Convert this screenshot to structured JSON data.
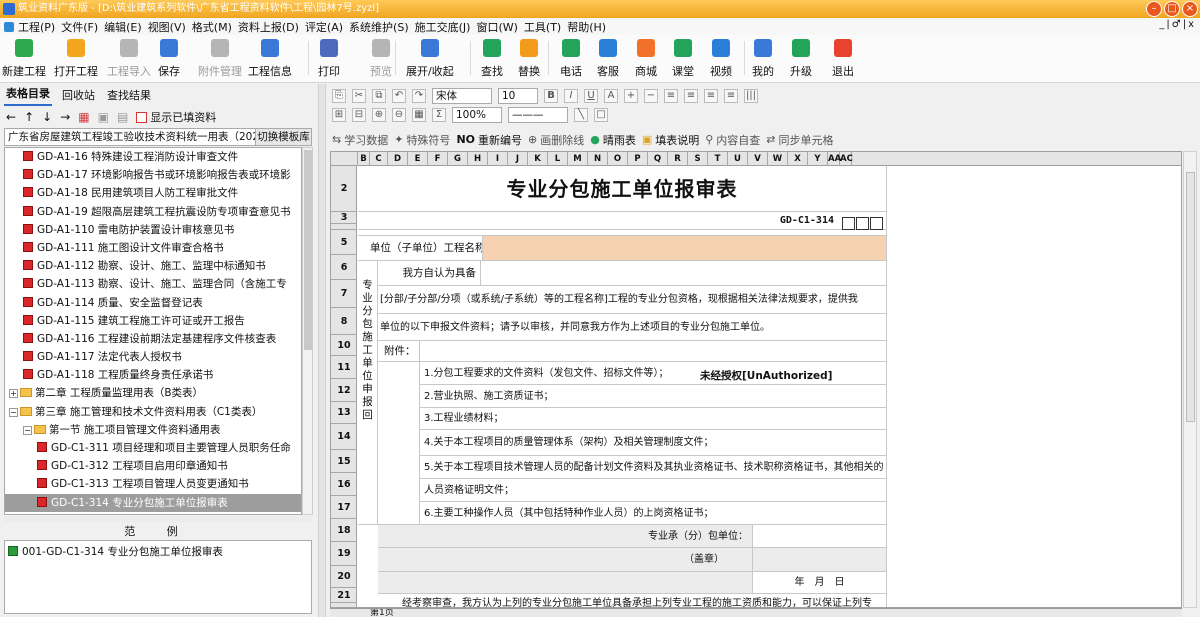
{
  "window": {
    "title": "筑业资料广东版 - [D:\\筑业建筑系列软件\\广东省工程资料软件\\工程\\园林7号.zyzl]"
  },
  "menu": [
    "工程(P)",
    "文件(F)",
    "编辑(E)",
    "视图(V)",
    "格式(M)",
    "资料上报(D)",
    "评定(A)",
    "系统维护(S)",
    "施工交底(J)",
    "窗口(W)",
    "工具(T)",
    "帮助(H)"
  ],
  "menu_right": "_|♂|x",
  "ribbon": [
    {
      "label": "新建工程",
      "icon": "new-project-icon",
      "color": "#2fa84f"
    },
    {
      "label": "打开工程",
      "icon": "open-project-icon",
      "color": "#f2a51d"
    },
    {
      "label": "工程导入",
      "icon": "import-project-icon",
      "color": "#b5b5b5",
      "disabled": true
    },
    {
      "label": "保存",
      "icon": "save-icon",
      "color": "#3a79d8"
    },
    {
      "label": "附件管理",
      "icon": "attachment-icon",
      "color": "#b5b5b5",
      "disabled": true
    },
    {
      "label": "工程信息",
      "icon": "project-info-icon",
      "color": "#3a79d8"
    },
    {
      "label": "打印",
      "icon": "print-icon",
      "color": "#4d6bbd"
    },
    {
      "label": "预览",
      "icon": "preview-icon",
      "color": "#b5b5b5",
      "disabled": true
    },
    {
      "label": "展开/收起",
      "icon": "expand-collapse-icon",
      "color": "#3a79d8"
    },
    {
      "label": "查找",
      "icon": "find-icon",
      "color": "#22a45b"
    },
    {
      "label": "替换",
      "icon": "replace-icon",
      "color": "#f29b1d"
    },
    {
      "label": "电话",
      "icon": "phone-icon",
      "color": "#22a45b"
    },
    {
      "label": "客服",
      "icon": "service-icon",
      "color": "#2b7fd8"
    },
    {
      "label": "商城",
      "icon": "shop-icon",
      "color": "#f1702a"
    },
    {
      "label": "课堂",
      "icon": "classroom-icon",
      "color": "#22a45b"
    },
    {
      "label": "视频",
      "icon": "video-icon",
      "color": "#2b7fd8"
    },
    {
      "label": "我的",
      "icon": "user-icon",
      "color": "#3a79d8"
    },
    {
      "label": "升级",
      "icon": "upgrade-icon",
      "color": "#22a45b"
    },
    {
      "label": "退出",
      "icon": "exit-icon",
      "color": "#e8432f"
    }
  ],
  "left_tabs": [
    "表格目录",
    "回收站",
    "查找结果"
  ],
  "left_tools": {
    "show_filled": "显示已填资料"
  },
  "left_combo": {
    "value": "广东省房屋建筑工程竣工验收技术资料统一用表（2024版）",
    "button": "切换模板库"
  },
  "tree": [
    {
      "label": "GD-A1-16 特殊建设工程消防设计审查文件",
      "type": "file",
      "indent": 2
    },
    {
      "label": "GD-A1-17 环境影响报告书或环境影响报告表或环境影",
      "type": "file",
      "indent": 2
    },
    {
      "label": "GD-A1-18 民用建筑项目人防工程审批文件",
      "type": "file",
      "indent": 2
    },
    {
      "label": "GD-A1-19 超限高层建筑工程抗震设防专项审查意见书",
      "type": "file",
      "indent": 2
    },
    {
      "label": "GD-A1-110 雷电防护装置设计审核意见书",
      "type": "file",
      "indent": 2
    },
    {
      "label": "GD-A1-111 施工图设计文件审查合格书",
      "type": "file",
      "indent": 2
    },
    {
      "label": "GD-A1-112 勘察、设计、施工、监理中标通知书",
      "type": "file",
      "indent": 2
    },
    {
      "label": "GD-A1-113 勘察、设计、施工、监理合同（含施工专",
      "type": "file",
      "indent": 2
    },
    {
      "label": "GD-A1-114 质量、安全监督登记表",
      "type": "file",
      "indent": 2
    },
    {
      "label": "GD-A1-115 建筑工程施工许可证或开工报告",
      "type": "file",
      "indent": 2
    },
    {
      "label": "GD-A1-116 工程建设前期法定基建程序文件核查表",
      "type": "file",
      "indent": 2
    },
    {
      "label": "GD-A1-117 法定代表人授权书",
      "type": "file",
      "indent": 2
    },
    {
      "label": "GD-A1-118 工程质量终身责任承诺书",
      "type": "file",
      "indent": 2
    },
    {
      "label": "第二章 工程质量监理用表（B类表）",
      "type": "folder",
      "indent": 1,
      "expander": "+"
    },
    {
      "label": "第三章 施工管理和技术文件资料用表（C1类表）",
      "type": "folder",
      "indent": 1,
      "expander": "-"
    },
    {
      "label": "第一节 施工项目管理文件资料通用表",
      "type": "folder",
      "indent": 2,
      "expander": "-"
    },
    {
      "label": "GD-C1-311 项目经理和项目主要管理人员职务任命",
      "type": "file",
      "indent": 3
    },
    {
      "label": "GD-C1-312 工程项目启用印章通知书",
      "type": "file",
      "indent": 3
    },
    {
      "label": "GD-C1-313 工程项目管理人员变更通知书",
      "type": "file",
      "indent": 3
    },
    {
      "label": "GD-C1-314 专业分包施工单位报审表",
      "type": "file",
      "indent": 3,
      "selected": true
    },
    {
      "label": "GD-C1-315 施工现场质量管理检查记录",
      "type": "file",
      "indent": 3
    }
  ],
  "examples": {
    "heading": "范 例",
    "items": [
      "001-GD-C1-314 专业分包施工单位报审表"
    ]
  },
  "editor_toolbar": {
    "font": "宋体",
    "size": "10",
    "zoom": "100%",
    "row3": [
      "学习数据",
      "特殊符号",
      "重新编号",
      "画删除线",
      "晴雨表",
      "填表说明",
      "内容自查",
      "同步单元格"
    ]
  },
  "columns": [
    "B",
    "C",
    "D",
    "E",
    "F",
    "G",
    "H",
    "I",
    "J",
    "K",
    "L",
    "M",
    "N",
    "O",
    "P",
    "Q",
    "R",
    "S",
    "T",
    "U",
    "V",
    "W",
    "X",
    "Y",
    "AA",
    "AC"
  ],
  "rows": [
    "2",
    "3",
    "4",
    "5",
    "6",
    "7",
    "8",
    "10",
    "11",
    "12",
    "13",
    "14",
    "15",
    "16",
    "17",
    "18",
    "19",
    "20",
    "21"
  ],
  "form": {
    "title": "专业分包施工单位报审表",
    "code": "GD-C1-314",
    "unit_label": "单位（子单位）工程名称",
    "self_qualified": "我方自认为具备",
    "line7": "[分部/子分部/分项（或系统/子系统）等的工程名称]工程的专业分包资格，现根据相关法律法规要求，提供我",
    "line8": "单位的以下申报文件资料；请予以审核，并同意我方作为上述项目的专业分包施工单位。",
    "attach": "附件：",
    "side": "专业分包施工单位申报回",
    "items": [
      "1.分包工程要求的文件资料（发包文件、招标文件等）；",
      "2.营业执照、施工资质证书；",
      "3.工程业绩材料；",
      "4.关于本工程项目的质量管理体系（架构）及相关管理制度文件；",
      "5.关于本工程项目技术管理人员的配备计划文件资料及其执业资格证书、技术职称资格证书，其他相关的",
      "人员资格证明文件；",
      "6.主要工种操作人员（其中包括特种作业人员）的上岗资格证书；"
    ],
    "sub_unit": "专业承（分）包单位：",
    "seal": "（盖章）",
    "date": "年　月　日",
    "row21": "经考察审查，我方认为上列的专业分包施工单位具备承担上列专业工程的施工资质和能力，可以保证上列专",
    "watermark": "未经授权[UnAuthorized]"
  },
  "sheet_tab": "第1页"
}
